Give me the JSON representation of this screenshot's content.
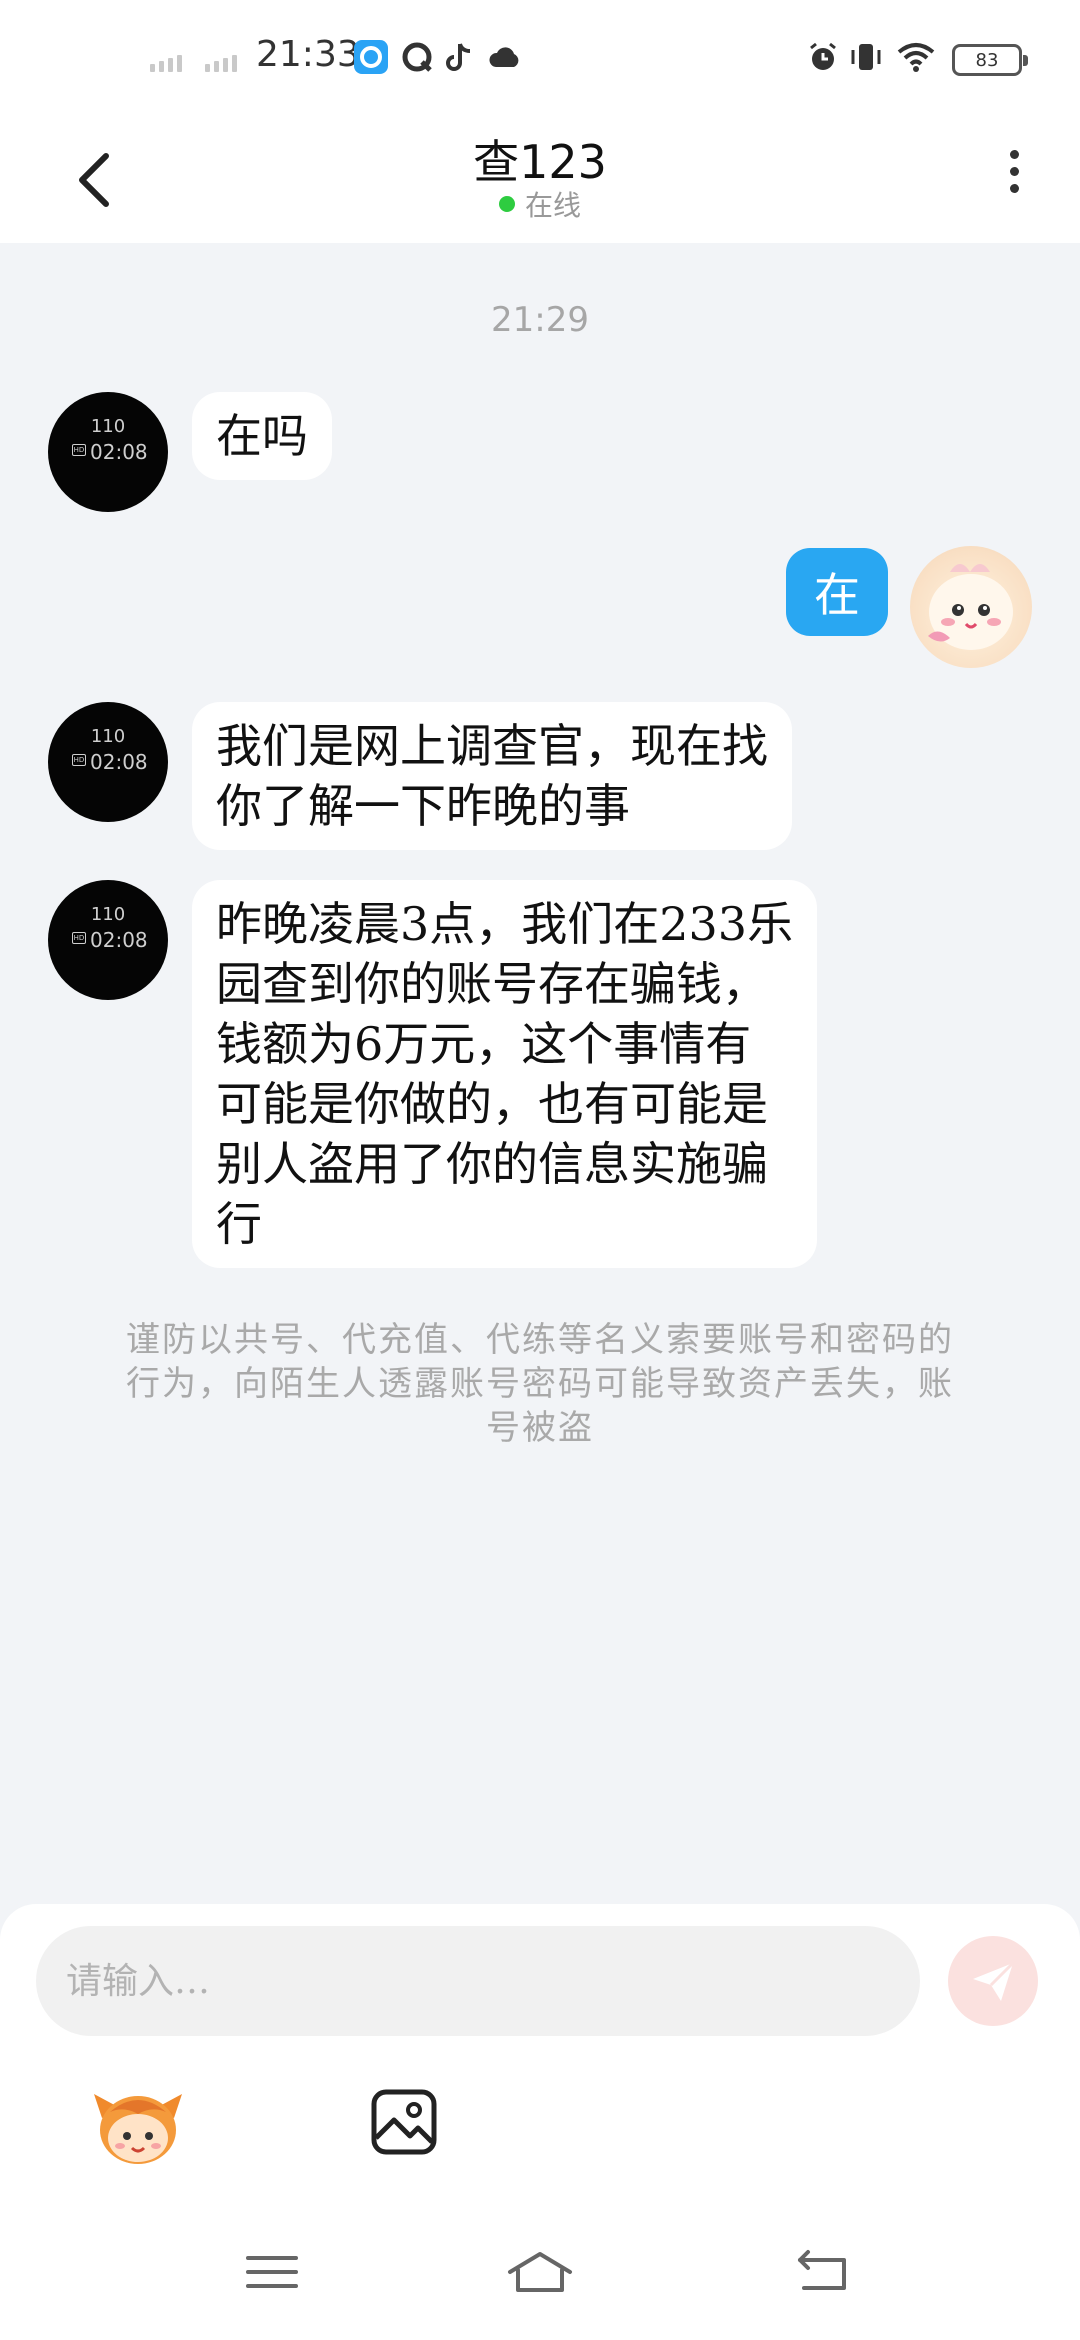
{
  "status_bar": {
    "time": "21:33",
    "battery": "83",
    "icons": [
      "signal-icon",
      "signal-icon",
      "app-notification-icon",
      "q-app-icon",
      "tiktok-icon",
      "cloud-icon",
      "alarm-icon",
      "vibrate-icon",
      "wifi-icon",
      "battery-icon"
    ]
  },
  "header": {
    "contact_name": "查123",
    "status": "在线",
    "online_color": "#2ecc40"
  },
  "chat": {
    "time_divider": "21:29",
    "watch_avatar": {
      "top_text": "110",
      "time": "02:08",
      "badge": "HD"
    },
    "messages": [
      {
        "side": "left",
        "text": "在吗"
      },
      {
        "side": "right",
        "text": "在"
      },
      {
        "side": "left",
        "text": "我们是网上调查官，现在找\n你了解一下昨晚的事"
      },
      {
        "side": "left",
        "text": "昨晚凌晨3点，我们在233乐\n园查到你的账号存在骗钱，\n钱额为6万元，这个事情有\n可能是你做的，也有可能是\n别人盗用了你的信息实施骗\n行"
      }
    ],
    "notice": "谨防以共号、代充值、代练等名义索要账号和密码的行为，向陌生人透露账号密码可能导致资产丢失，账号被盗"
  },
  "composer": {
    "placeholder": "请输入…",
    "send_color": "#fbe1df",
    "accent": "#29a7f2"
  },
  "nav": {
    "buttons": [
      "menu-icon",
      "home-icon",
      "back-nav-icon"
    ]
  }
}
